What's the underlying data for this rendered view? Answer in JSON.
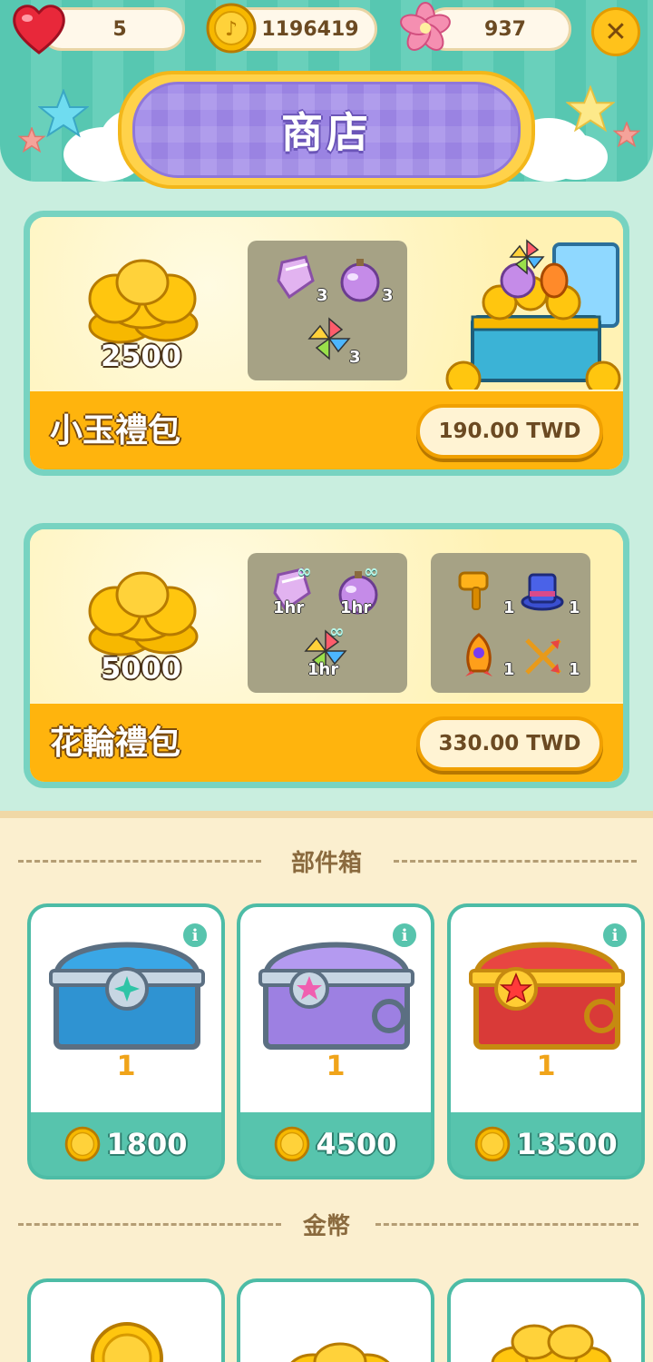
{
  "resources": {
    "hearts": "5",
    "coins": "1196419",
    "sakura": "937"
  },
  "title": "商店",
  "packs": [
    {
      "name": "小玉禮包",
      "coins": "2500",
      "items": [
        {
          "icon": "crystal-booster-icon",
          "count": "3"
        },
        {
          "icon": "bomb-booster-icon",
          "count": "3"
        },
        {
          "icon": "pinwheel-booster-icon",
          "count": "3"
        }
      ],
      "price": "190.00 TWD"
    },
    {
      "name": "花輪禮包",
      "coins": "5000",
      "timed_items": [
        {
          "icon": "crystal-booster-icon",
          "duration": "1hr",
          "infinite": "∞"
        },
        {
          "icon": "bomb-booster-icon",
          "duration": "1hr",
          "infinite": "∞"
        },
        {
          "icon": "pinwheel-booster-icon",
          "duration": "1hr",
          "infinite": "∞"
        }
      ],
      "tools": [
        {
          "icon": "hammer-icon",
          "count": "1"
        },
        {
          "icon": "magic-hat-icon",
          "count": "1"
        },
        {
          "icon": "rocket-icon",
          "count": "1"
        },
        {
          "icon": "arrows-icon",
          "count": "1"
        }
      ],
      "price": "330.00 TWD"
    }
  ],
  "parts_section": {
    "title": "部件箱",
    "chests": [
      {
        "color": "#3aa7e6",
        "count": "1",
        "price": "1800"
      },
      {
        "color": "#a98ae8",
        "count": "1",
        "price": "4500"
      },
      {
        "color": "#e84542",
        "count": "1",
        "price": "13500"
      }
    ]
  },
  "coins_section": {
    "title": "金幣"
  },
  "colors": {
    "mint": "#c9eedf",
    "teal": "#57c4ad",
    "orange": "#ffb40d",
    "cream": "#fbefcf",
    "purple": "#a792ea"
  }
}
